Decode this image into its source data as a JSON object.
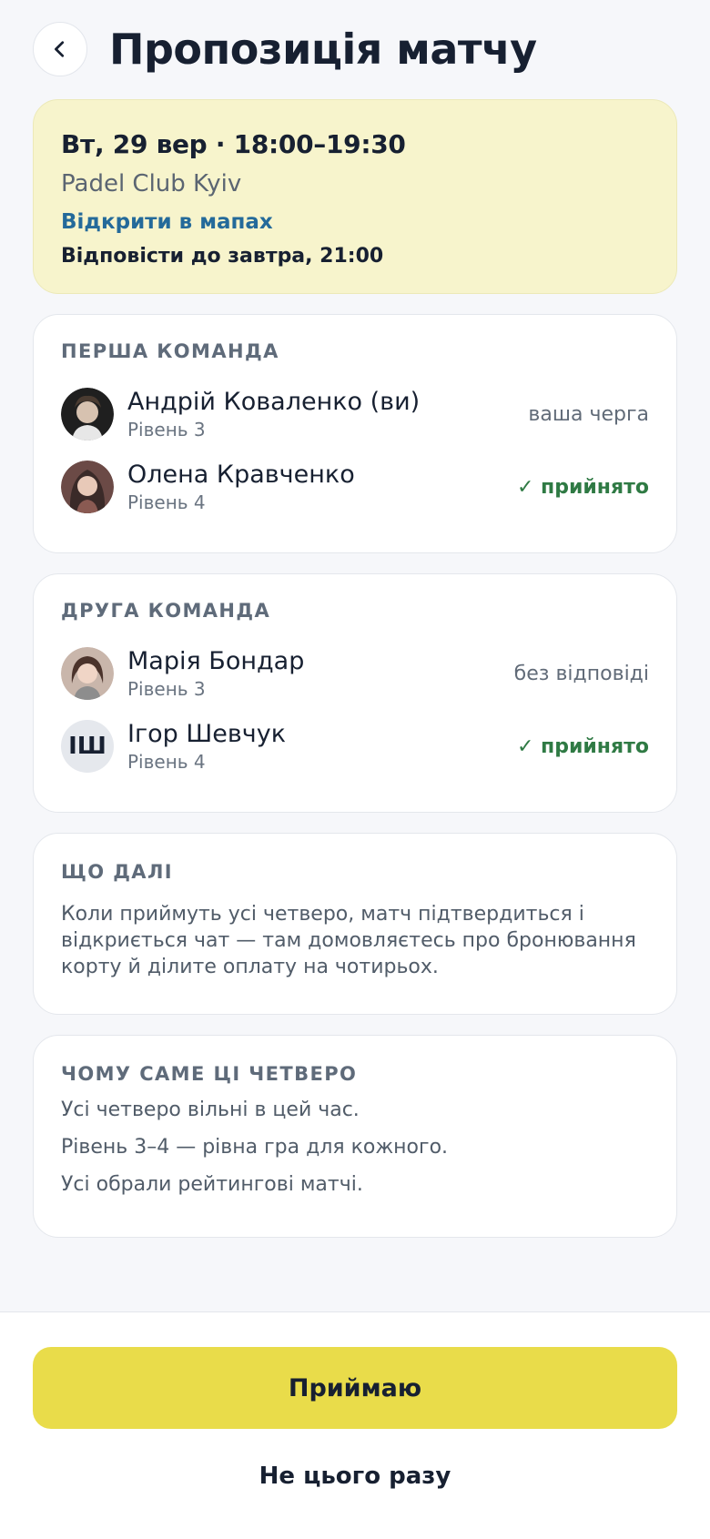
{
  "header": {
    "back_icon": "chevron-left-icon",
    "title": "Пропозиція матчу"
  },
  "match": {
    "datetime": "Вт, 29 вер · 18:00–19:30",
    "venue": "Padel Club Kyiv",
    "map_link": "Відкрити в мапах",
    "deadline": "Відповісти до завтра, 21:00"
  },
  "teams": [
    {
      "title": "ПЕРША КОМАНДА",
      "players": [
        {
          "name": "Андрій Коваленко (ви)",
          "level": "Рівень 3",
          "status": "ваша черга",
          "avatar": "photo"
        },
        {
          "name": "Олена Кравченко",
          "level": "Рівень 4",
          "status": "✓ прийнято",
          "avatar": "photo"
        }
      ]
    },
    {
      "title": "ДРУГА КОМАНДА",
      "players": [
        {
          "name": "Марія Бондар",
          "level": "Рівень 3",
          "status": "без відповіді",
          "avatar": "photo"
        },
        {
          "name": "Ігор Шевчук",
          "level": "Рівень 4",
          "status": "✓ прийнято",
          "avatar": "ІШ"
        }
      ]
    }
  ],
  "next": {
    "title": "ЩО ДАЛІ",
    "text": "Коли приймуть усі четверо, матч підтвердиться і відкриється чат — там домовляєтесь про бронювання корту й ділите оплату на чотирьох."
  },
  "why": {
    "title": "ЧОМУ САМЕ ЦІ ЧЕТВЕРО",
    "reasons": [
      "Усі четверо вільні в цей час.",
      "Рівень 3–4 — рівна гра для кожного.",
      "Усі обрали рейтингові матчі."
    ]
  },
  "actions": {
    "accept": "Приймаю",
    "decline": "Не цього разу"
  },
  "colors": {
    "accent_yellow": "#e9dc4a",
    "hero_background": "#f7f4cc",
    "link_blue": "#246a9a",
    "accepted_green": "#2f7a44"
  }
}
